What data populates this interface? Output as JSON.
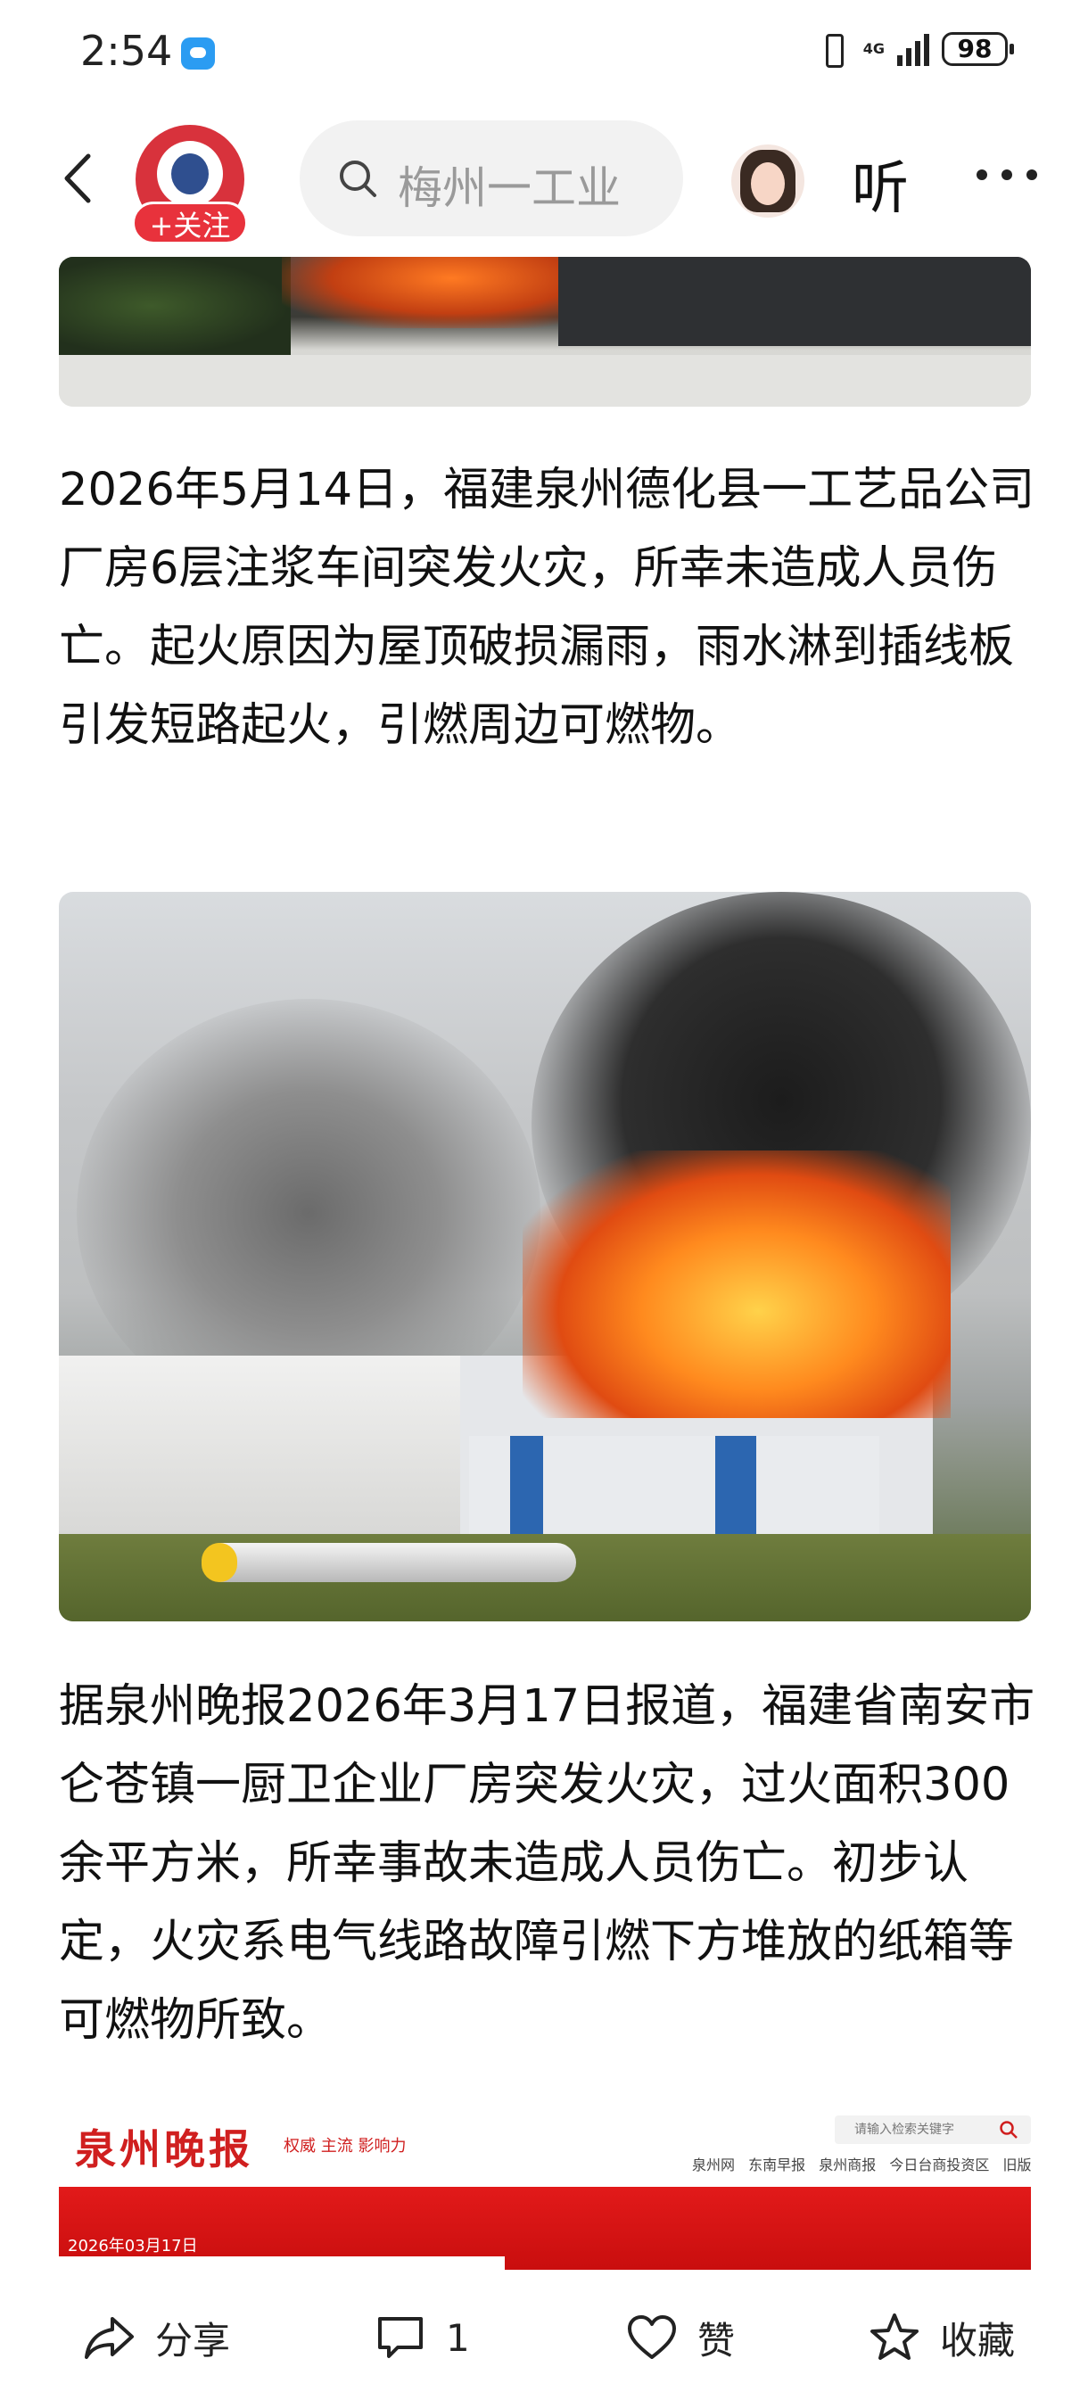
{
  "status_bar": {
    "time": "2:54",
    "network": "4G",
    "battery": "98"
  },
  "header": {
    "follow_label": "+关注",
    "search_text": "梅州一工业",
    "listen_label": "听"
  },
  "article": {
    "paragraph_1": "2026年5月14日，福建泉州德化县一工艺品公司厂房6层注浆车间突发火灾，所幸未造成人员伤亡。起火原因为屋顶破损漏雨，雨水淋到插线板引发短路起火，引燃周边可燃物。",
    "paragraph_2": "据泉州晚报2026年3月17日报道，福建省南安市仑苍镇一厨卫企业厂房突发火灾，过火面积300余平方米，所幸事故未造成人员伤亡。初步认定，火灾系电气线路故障引燃下方堆放的纸箱等可燃物所致。"
  },
  "newspaper": {
    "logo": "泉州晚报",
    "tagline": "权威 主流 影响力",
    "search_placeholder": "请输入检索关键字",
    "links": [
      "泉州网",
      "东南早报",
      "泉州商报",
      "今日台商投资区",
      "旧版入口"
    ],
    "date": "2026年03月17日"
  },
  "bottom_bar": {
    "share": "分享",
    "comment_count": "1",
    "like": "赞",
    "favorite": "收藏"
  },
  "icons": {
    "back": "chevron-left-icon",
    "search": "search-icon",
    "more": "more-dots-icon",
    "share": "share-icon",
    "comment": "comment-icon",
    "like": "heart-icon",
    "favorite": "star-icon"
  }
}
